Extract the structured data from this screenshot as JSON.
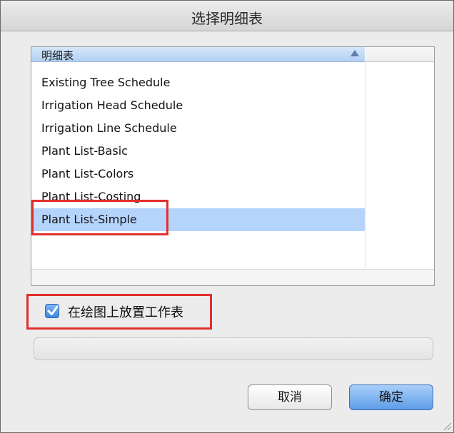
{
  "window": {
    "title": "选择明细表"
  },
  "list": {
    "header": "明细表",
    "items": [
      "Existing Tree Schedule",
      "Irrigation Head Schedule",
      "Irrigation Line Schedule",
      "Plant List-Basic",
      "Plant List-Colors",
      "Plant List-Costing",
      "Plant List-Simple"
    ],
    "selected_index": 6
  },
  "checkbox": {
    "label": "在绘图上放置工作表",
    "checked": true
  },
  "progress": {
    "value": 0
  },
  "buttons": {
    "cancel": "取消",
    "ok": "确定"
  },
  "colors": {
    "highlight": "#e0302d",
    "selection": "#b5d4fc",
    "accent": "#5e9de8"
  }
}
